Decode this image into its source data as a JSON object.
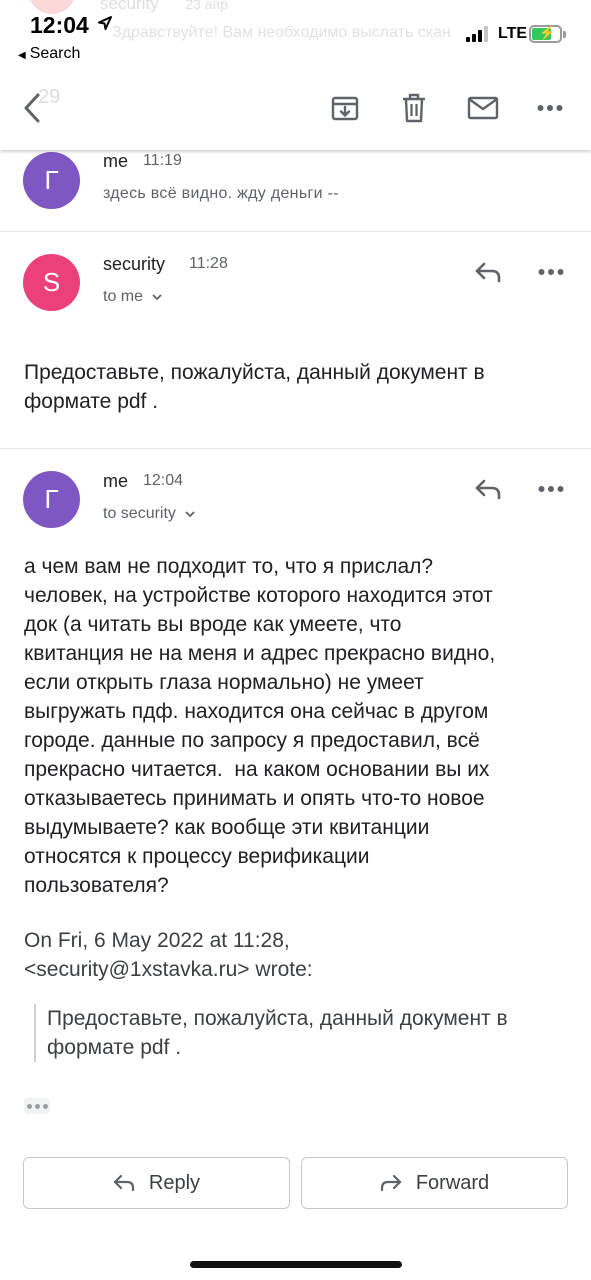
{
  "status_bar": {
    "time": "12:04",
    "back_app": "Search",
    "network": "LTE",
    "ghost_sender": "security",
    "ghost_time": "23 апр",
    "ghost_preview": "Здравствуйте! Вам необходимо выслать скан"
  },
  "toolbar": {
    "ghost_subject": "29",
    "icons": [
      "back-arrow-icon",
      "archive-icon",
      "trash-icon",
      "mail-icon",
      "more-icon"
    ]
  },
  "messages": [
    {
      "avatar_letter": "Г",
      "avatar_color": "#7e57c2",
      "sender": "me",
      "time": "11:19",
      "snippet": "здесь всё видно. жду деньги --"
    },
    {
      "avatar_letter": "S",
      "avatar_color": "#ec407a",
      "sender": "security",
      "time": "11:28",
      "recipients": "to me",
      "body": "Предоставьте, пожалуйста, данный документ в\nформате pdf ."
    },
    {
      "avatar_letter": "Г",
      "avatar_color": "#7e57c2",
      "sender": "me",
      "time": "12:04",
      "recipients": "to security",
      "body": "а чем вам не подходит то, что я прислал?\nчеловек, на устройстве которого находится этот\nдок (а читать вы вроде как умеете, что\nквитанция не на меня и адрес прекрасно видно,\nесли открыть глаза нормально) не умеет\nвыгружать пдф. находится она сейчас в другом\nгороде. данные по запросу я предоставил, всё\nпрекрасно читается.  на каком основании вы их\nотказываетесь принимать и опять что-то новое\nвыдумываете? как вообще эти квитанции\nотносятся к процессу верификации\nпользователя?",
      "quote_header": "On Fri, 6 May 2022 at 11:28,\n<security@1xstavka.ru> wrote:",
      "quote": "Предоставьте, пожалуйста, данный документ в\nформате pdf ."
    }
  ],
  "actions": {
    "reply_label": "Reply",
    "forward_label": "Forward"
  }
}
